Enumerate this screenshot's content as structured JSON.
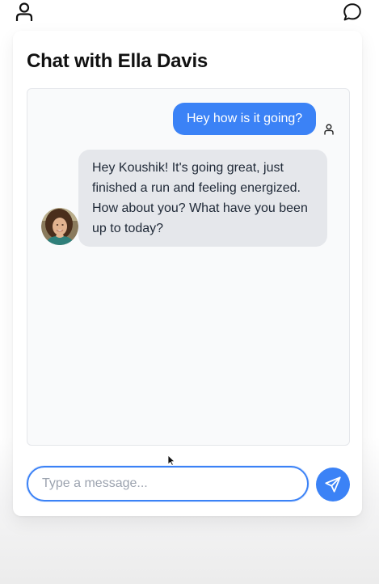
{
  "topbar": {
    "profile_icon": "user-icon",
    "chat_icon": "chat-bubble-icon"
  },
  "chat": {
    "title": "Chat with Ella Davis",
    "messages": [
      {
        "direction": "outgoing",
        "text": "Hey how is it going?",
        "sender_icon": "user-icon"
      },
      {
        "direction": "incoming",
        "text": "Hey Koushik! It's going great, just finished a run and feeling energized. How about you? What have you been up to today?",
        "avatar": "avatar-ella-davis"
      }
    ]
  },
  "composer": {
    "placeholder": "Type a message...",
    "value": "",
    "send_icon": "send-icon"
  },
  "colors": {
    "accent": "#3b82f6",
    "incoming_bubble": "#e5e7eb",
    "outgoing_text": "#ffffff",
    "panel_bg": "#f9fafb"
  }
}
